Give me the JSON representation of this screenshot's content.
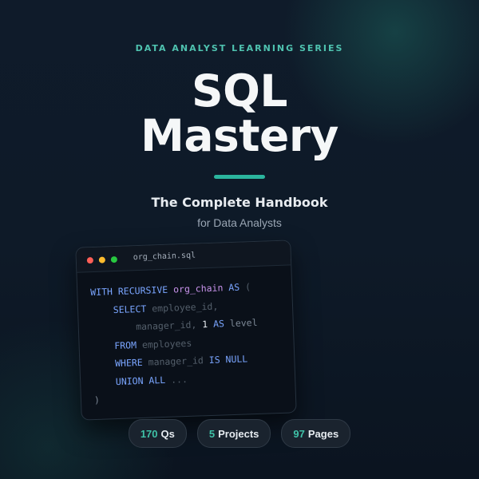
{
  "header": {
    "series": "DATA ANALYST LEARNING SERIES",
    "title_line1": "SQL",
    "title_line2": "Mastery",
    "subtitle": "The Complete Handbook",
    "tagline": "for Data Analysts"
  },
  "editor": {
    "filename": "org_chain.sql",
    "code": {
      "l1_kw": "WITH RECURSIVE",
      "l1_name": "org_chain",
      "l1_as": "AS",
      "l1_paren": "(",
      "l2_kw": "SELECT",
      "l2_id": "employee_id,",
      "l3_id": "manager_id,",
      "l3_num": "1",
      "l3_as": "AS",
      "l3_level": "level",
      "l4_kw": "FROM",
      "l4_id": "employees",
      "l5_kw": "WHERE",
      "l5_id": "manager_id",
      "l5_is": "IS NULL",
      "l6_kw": "UNION ALL",
      "l6_rest": "...",
      "l7_paren": ")"
    }
  },
  "stats": [
    {
      "number": "170",
      "label": "Qs"
    },
    {
      "number": "5",
      "label": "Projects"
    },
    {
      "number": "97",
      "label": "Pages"
    }
  ],
  "colors": {
    "accent": "#2bb59e",
    "keyword": "#7aa5ff",
    "cte_name": "#c792ea",
    "background": "#0e1a28"
  }
}
